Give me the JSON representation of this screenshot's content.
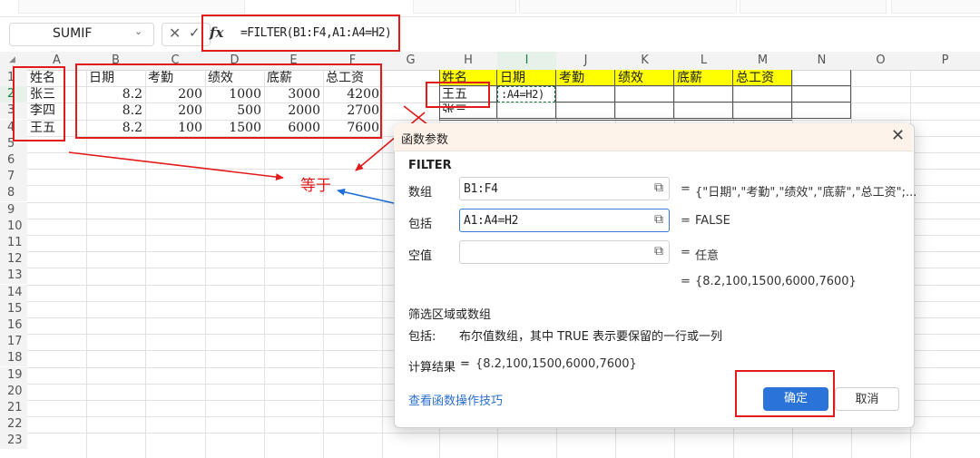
{
  "formula_bar": {
    "name_box": "SUMIF",
    "cancel_icon": "✕",
    "enter_icon": "✓",
    "fx_label": "fx",
    "formula": "=FILTER(B1:F4,A1:A4=H2)"
  },
  "columns": [
    "A",
    "B",
    "C",
    "D",
    "E",
    "F",
    "G",
    "H",
    "I",
    "J",
    "K",
    "L",
    "M",
    "N",
    "O",
    "P"
  ],
  "selected_column": "I",
  "selected_row": "2",
  "rows": [
    "1",
    "2",
    "3",
    "4",
    "5",
    "6",
    "7",
    "8",
    "9",
    "10",
    "11",
    "12",
    "13",
    "14",
    "15",
    "16",
    "17",
    "18",
    "19",
    "20",
    "21",
    "22",
    "23"
  ],
  "source_table": {
    "names_header": "姓名",
    "names": [
      "张三",
      "李四",
      "王五"
    ],
    "headers": [
      "日期",
      "考勤",
      "绩效",
      "底薪",
      "总工资"
    ],
    "data": [
      [
        "8.2",
        "200",
        "1000",
        "3000",
        "4200"
      ],
      [
        "8.2",
        "200",
        "500",
        "2000",
        "2700"
      ],
      [
        "8.2",
        "100",
        "1500",
        "6000",
        "7600"
      ]
    ]
  },
  "result_table": {
    "headers": [
      "姓名",
      "日期",
      "考勤",
      "绩效",
      "底薪",
      "总工资"
    ],
    "lookup_names": [
      "王五",
      "张三"
    ],
    "editing_cell": ":A4=H2)"
  },
  "annotation": "等于",
  "dialog": {
    "title": "函数参数",
    "function_name": "FILTER",
    "args": [
      {
        "label": "数组",
        "value": "B1:F4",
        "result": "{\"日期\",\"考勤\",\"绩效\",\"底薪\",\"总工资\";..."
      },
      {
        "label": "包括",
        "value": "A1:A4=H2",
        "result": "FALSE"
      },
      {
        "label": "空值",
        "value": "",
        "result": "任意"
      }
    ],
    "equals": "=",
    "preview_result": "{8.2,100,1500,6000,7600}",
    "description_title": "筛选区域或数组",
    "param_desc_label": "包括:",
    "param_desc": "布尔值数组，其中 TRUE 表示要保留的一行或一列",
    "calc_label": "计算结果",
    "calc_result": "{8.2,100,1500,6000,7600}",
    "help_link": "查看函数操作技巧",
    "ok_label": "确定",
    "cancel_label": "取消",
    "close_icon": "✕",
    "range_picker_icon": "⧉"
  },
  "colors": {
    "annotation_red": "#e31a1a",
    "arrow_blue": "#1f6fd6",
    "accent_blue": "#2a73d9",
    "header_yellow": "#ffff00",
    "selection_green": "#217346"
  }
}
